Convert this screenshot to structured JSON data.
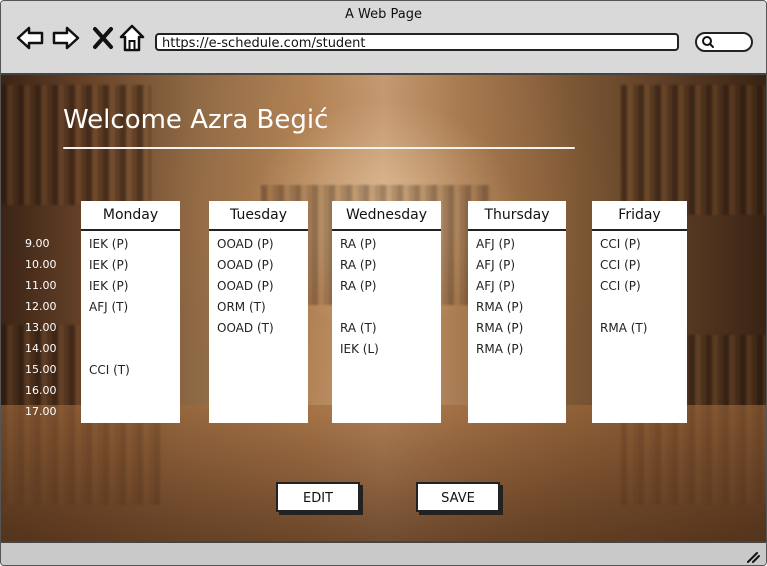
{
  "window": {
    "title": "A Web Page"
  },
  "browser": {
    "url": "https://e-schedule.com/student",
    "icons": [
      "back-arrow-icon",
      "forward-arrow-icon",
      "close-x-icon",
      "home-icon",
      "search-icon",
      "resize-grip-icon"
    ]
  },
  "page": {
    "welcome": "Welcome Azra Begić"
  },
  "schedule": {
    "times": [
      "9.00",
      "10.00",
      "11.00",
      "12.00",
      "13.00",
      "14.00",
      "15.00",
      "16.00",
      "17.00"
    ],
    "days": [
      {
        "name": "Monday",
        "entries": [
          "IEK (P)",
          "IEK (P)",
          "IEK (P)",
          "AFJ (T)",
          "",
          "",
          "CCI (T)",
          "",
          ""
        ]
      },
      {
        "name": "Tuesday",
        "entries": [
          "OOAD (P)",
          "OOAD (P)",
          "OOAD (P)",
          "ORM (T)",
          "OOAD (T)",
          "",
          "",
          "",
          ""
        ]
      },
      {
        "name": "Wednesday",
        "entries": [
          "RA (P)",
          "RA (P)",
          "RA (P)",
          "",
          "RA (T)",
          "IEK (L)",
          "",
          "",
          ""
        ]
      },
      {
        "name": "Thursday",
        "entries": [
          "AFJ (P)",
          "AFJ (P)",
          "AFJ (P)",
          "RMA (P)",
          "RMA (P)",
          "RMA (P)",
          "",
          "",
          ""
        ]
      },
      {
        "name": "Friday",
        "entries": [
          "CCI (P)",
          "CCI (P)",
          "CCI (P)",
          "",
          "RMA (T)",
          "",
          "",
          "",
          ""
        ]
      }
    ]
  },
  "actions": {
    "edit_label": "EDIT",
    "save_label": "SAVE"
  }
}
